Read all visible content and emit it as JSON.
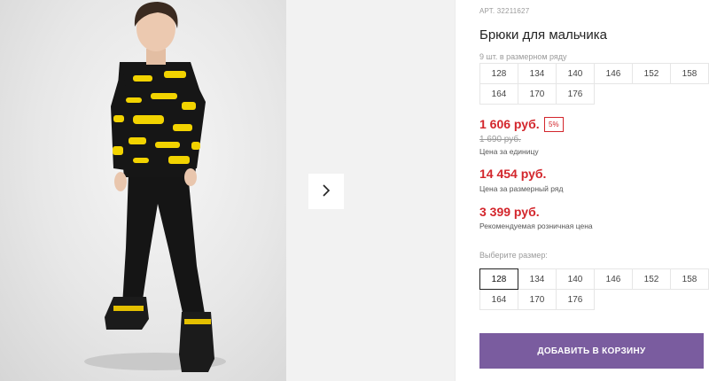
{
  "product": {
    "article": "АРТ. 32211627",
    "title": "Брюки для мальчика",
    "row_info": "9 шт. в размерном ряду",
    "row_sizes": [
      "128",
      "134",
      "140",
      "146",
      "152",
      "158",
      "164",
      "170",
      "176"
    ]
  },
  "gallery": {
    "next_icon": "chevron-right-icon",
    "background_color": "#e8e8e8"
  },
  "pricing": {
    "unit_price": "1 606 руб.",
    "discount_badge": "5%",
    "old_price": "1 690 руб.",
    "unit_caption": "Цена за единицу",
    "row_price": "14 454 руб.",
    "row_caption": "Цена за размерный ряд",
    "rrp_price": "3 399 руб.",
    "rrp_caption": "Рекомендуемая розничная цена",
    "price_color": "#d3262c"
  },
  "size_select": {
    "label": "Выберите размер:",
    "sizes": [
      "128",
      "134",
      "140",
      "146",
      "152",
      "158",
      "164",
      "170",
      "176"
    ],
    "selected": "128"
  },
  "cart": {
    "add_label": "ДОБАВИТЬ В КОРЗИНУ",
    "button_color": "#7a5c9f"
  }
}
